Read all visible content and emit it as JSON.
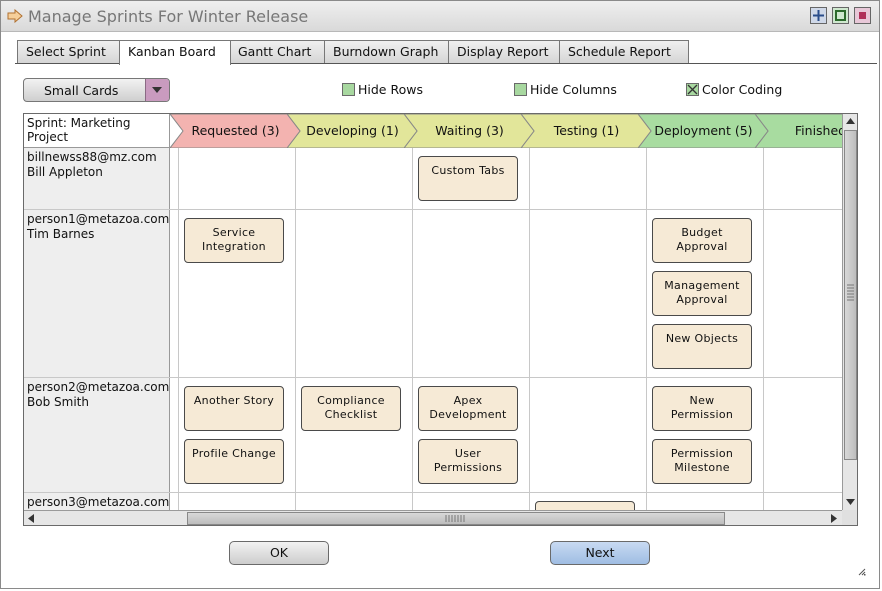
{
  "window": {
    "title": "Manage Sprints For Winter Release",
    "controls": [
      "add-icon",
      "maximize-icon",
      "close-icon"
    ]
  },
  "tabs": [
    {
      "label": "Select Sprint",
      "active": false
    },
    {
      "label": "Kanban Board",
      "active": true
    },
    {
      "label": "Gantt Chart",
      "active": false
    },
    {
      "label": "Burndown Graph",
      "active": false
    },
    {
      "label": "Display Report",
      "active": false
    },
    {
      "label": "Schedule Report",
      "active": false
    }
  ],
  "toolbar": {
    "card_size": "Small Cards",
    "hide_rows": {
      "label": "Hide Rows",
      "checked": false
    },
    "hide_columns": {
      "label": "Hide Columns",
      "checked": false
    },
    "color_coding": {
      "label": "Color Coding",
      "checked": true
    }
  },
  "board": {
    "sprint_label": "Sprint: Marketing Project",
    "columns": [
      {
        "label": "Requested (3)",
        "color": "#f3b3b0"
      },
      {
        "label": "Developing (1)",
        "color": "#e2e69a"
      },
      {
        "label": "Waiting (3)",
        "color": "#e2e69a"
      },
      {
        "label": "Testing (1)",
        "color": "#e2e69a"
      },
      {
        "label": "Deployment (5)",
        "color": "#a8dca0"
      },
      {
        "label": "Finished",
        "color": "#a8dca0"
      }
    ],
    "rows": [
      {
        "email": "billnewss88@mz.com",
        "name": "Bill Appleton",
        "cards": [
          {
            "col": 2,
            "slot": 0,
            "line1": "Custom Tabs",
            "line2": ""
          }
        ]
      },
      {
        "email": "person1@metazoa.com",
        "name": "Tim Barnes",
        "cards": [
          {
            "col": 0,
            "slot": 0,
            "line1": "Service",
            "line2": "Integration"
          },
          {
            "col": 4,
            "slot": 0,
            "line1": "Budget",
            "line2": "Approval"
          },
          {
            "col": 4,
            "slot": 1,
            "line1": "Management",
            "line2": "Approval"
          },
          {
            "col": 4,
            "slot": 2,
            "line1": "New Objects",
            "line2": ""
          }
        ]
      },
      {
        "email": "person2@metazoa.com",
        "name": "Bob Smith",
        "cards": [
          {
            "col": 0,
            "slot": 0,
            "line1": "Another Story",
            "line2": ""
          },
          {
            "col": 0,
            "slot": 1,
            "line1": "Profile Change",
            "line2": ""
          },
          {
            "col": 1,
            "slot": 0,
            "line1": "Compliance",
            "line2": "Checklist"
          },
          {
            "col": 2,
            "slot": 0,
            "line1": "Apex",
            "line2": "Development"
          },
          {
            "col": 2,
            "slot": 1,
            "line1": "User",
            "line2": "Permissions"
          },
          {
            "col": 4,
            "slot": 0,
            "line1": "New",
            "line2": "Permission"
          },
          {
            "col": 4,
            "slot": 1,
            "line1": "Permission",
            "line2": "Milestone"
          }
        ]
      },
      {
        "email": "person3@metazoa.com",
        "name": "",
        "cards": [
          {
            "col": 3,
            "slot": 0,
            "line1": "",
            "line2": ""
          }
        ]
      }
    ]
  },
  "buttons": {
    "ok": "OK",
    "next": "Next"
  }
}
